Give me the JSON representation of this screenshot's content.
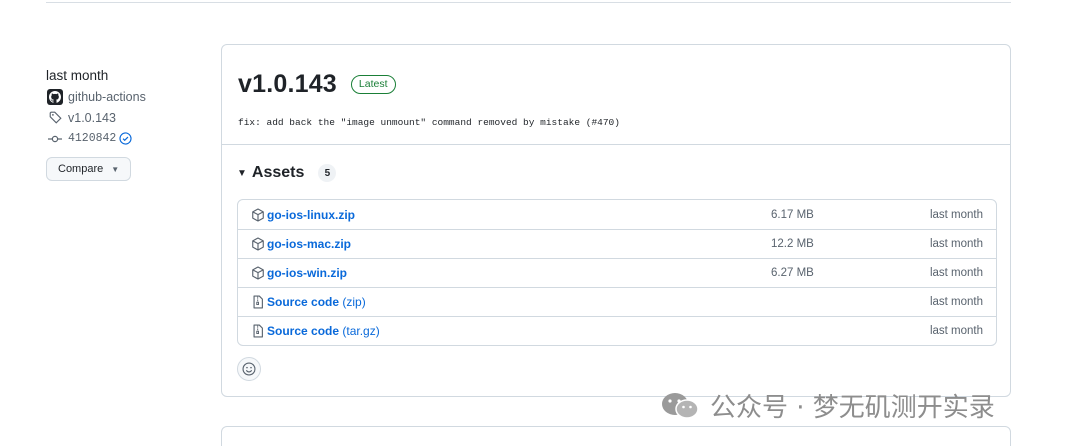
{
  "meta": {
    "date": "last month",
    "author": "github-actions",
    "tag": "v1.0.143",
    "commit": "4120842",
    "compare_label": "Compare"
  },
  "release": {
    "title": "v1.0.143",
    "badge": "Latest",
    "notes": "fix: add back the \"image unmount\" command removed by mistake (#470)"
  },
  "assets": {
    "label": "Assets",
    "count": "5",
    "items": [
      {
        "name": "go-ios-linux.zip",
        "suffix": "",
        "size": "6.17 MB",
        "date": "last month",
        "icon": "package-icon"
      },
      {
        "name": "go-ios-mac.zip",
        "suffix": "",
        "size": "12.2 MB",
        "date": "last month",
        "icon": "package-icon"
      },
      {
        "name": "go-ios-win.zip",
        "suffix": "",
        "size": "6.27 MB",
        "date": "last month",
        "icon": "package-icon"
      },
      {
        "name": "Source code",
        "suffix": "(zip)",
        "size": "",
        "date": "last month",
        "icon": "file-zip-icon"
      },
      {
        "name": "Source code",
        "suffix": "(tar.gz)",
        "size": "",
        "date": "last month",
        "icon": "file-zip-icon"
      }
    ]
  },
  "watermark": {
    "text": "公众号 · 梦无矶测开实录"
  },
  "colors": {
    "link": "#0969da",
    "latest": "#1a7f37",
    "muted": "#59636e",
    "border": "#d1d9e0"
  }
}
